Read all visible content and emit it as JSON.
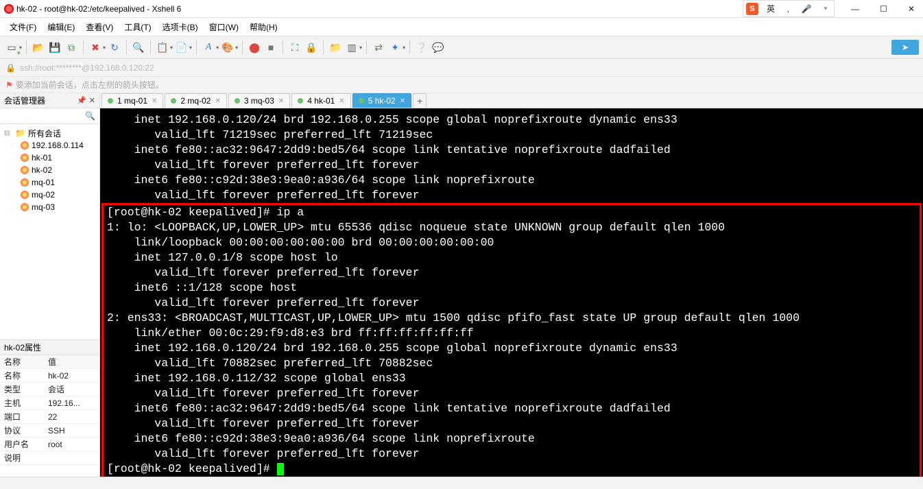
{
  "window": {
    "title": "hk-02 - root@hk-02:/etc/keepalived - Xshell 6",
    "ime_label": "英",
    "ime_extra": "‚",
    "address": "ssh://root:********@192.168.0.120:22",
    "tip": "要添加当前会话，点击左侧的箭头按钮。"
  },
  "menu": {
    "file": "文件(F)",
    "edit": "编辑(E)",
    "view": "查看(V)",
    "tools": "工具(T)",
    "tabs": "选项卡(B)",
    "window": "窗口(W)",
    "help": "帮助(H)"
  },
  "session_panel": {
    "title": "会话管理器",
    "root": "所有会话",
    "sessions": [
      "192.168.0.114",
      "hk-01",
      "hk-02",
      "mq-01",
      "mq-02",
      "mq-03"
    ]
  },
  "props_panel": {
    "title": "hk-02属性",
    "name_hdr": "名称",
    "value_hdr": "值",
    "rows": [
      {
        "k": "名称",
        "v": "hk-02"
      },
      {
        "k": "类型",
        "v": "会话"
      },
      {
        "k": "主机",
        "v": "192.16..."
      },
      {
        "k": "端口",
        "v": "22"
      },
      {
        "k": "协议",
        "v": "SSH"
      },
      {
        "k": "用户名",
        "v": "root"
      },
      {
        "k": "说明",
        "v": ""
      }
    ]
  },
  "tabs": [
    {
      "id": "1",
      "label": "1 mq-01",
      "active": false
    },
    {
      "id": "2",
      "label": "2 mq-02",
      "active": false
    },
    {
      "id": "3",
      "label": "3 mq-03",
      "active": false
    },
    {
      "id": "4",
      "label": "4 hk-01",
      "active": false
    },
    {
      "id": "5",
      "label": "5 hk-02",
      "active": true
    }
  ],
  "terminal": {
    "pre_lines": [
      "    inet 192.168.0.120/24 brd 192.168.0.255 scope global noprefixroute dynamic ens33",
      "       valid_lft 71219sec preferred_lft 71219sec",
      "    inet6 fe80::ac32:9647:2dd9:bed5/64 scope link tentative noprefixroute dadfailed",
      "       valid_lft forever preferred_lft forever",
      "    inet6 fe80::c92d:38e3:9ea0:a936/64 scope link noprefixroute",
      "       valid_lft forever preferred_lft forever"
    ],
    "box_lines": [
      "[root@hk-02 keepalived]# ip a",
      "1: lo: <LOOPBACK,UP,LOWER_UP> mtu 65536 qdisc noqueue state UNKNOWN group default qlen 1000",
      "    link/loopback 00:00:00:00:00:00 brd 00:00:00:00:00:00",
      "    inet 127.0.0.1/8 scope host lo",
      "       valid_lft forever preferred_lft forever",
      "    inet6 ::1/128 scope host",
      "       valid_lft forever preferred_lft forever",
      "2: ens33: <BROADCAST,MULTICAST,UP,LOWER_UP> mtu 1500 qdisc pfifo_fast state UP group default qlen 1000",
      "    link/ether 00:0c:29:f9:d8:e3 brd ff:ff:ff:ff:ff:ff",
      "    inet 192.168.0.120/24 brd 192.168.0.255 scope global noprefixroute dynamic ens33",
      "       valid_lft 70882sec preferred_lft 70882sec",
      "    inet 192.168.0.112/32 scope global ens33",
      "       valid_lft forever preferred_lft forever",
      "    inet6 fe80::ac32:9647:2dd9:bed5/64 scope link tentative noprefixroute dadfailed",
      "       valid_lft forever preferred_lft forever",
      "    inet6 fe80::c92d:38e3:9ea0:a936/64 scope link noprefixroute",
      "       valid_lft forever preferred_lft forever",
      "[root@hk-02 keepalived]# "
    ]
  }
}
